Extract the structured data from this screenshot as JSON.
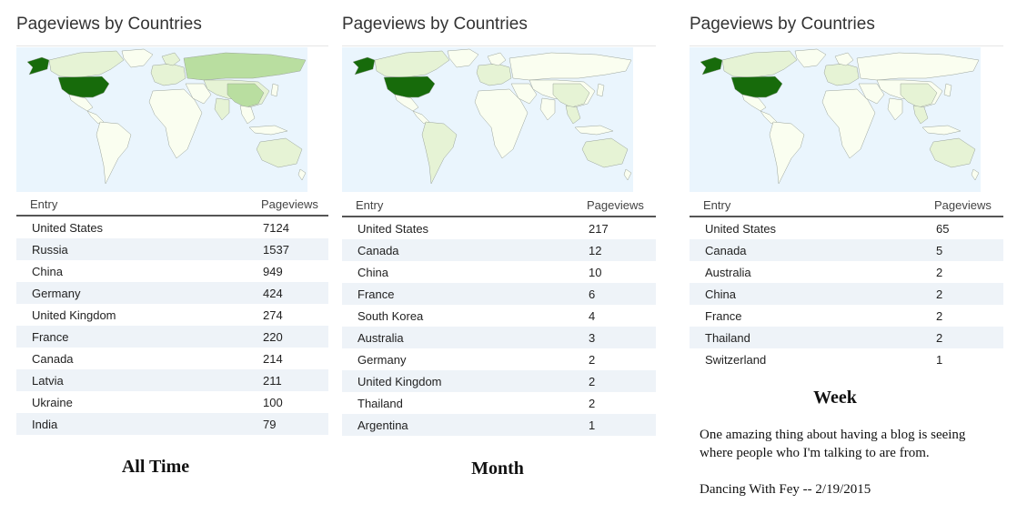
{
  "panels": [
    {
      "title": "Pageviews by Countries",
      "columns": {
        "entry": "Entry",
        "pageviews": "Pageviews"
      },
      "rows": [
        {
          "entry": "United States",
          "pageviews": "7124"
        },
        {
          "entry": "Russia",
          "pageviews": "1537"
        },
        {
          "entry": "China",
          "pageviews": "949"
        },
        {
          "entry": "Germany",
          "pageviews": "424"
        },
        {
          "entry": "United Kingdom",
          "pageviews": "274"
        },
        {
          "entry": "France",
          "pageviews": "220"
        },
        {
          "entry": "Canada",
          "pageviews": "214"
        },
        {
          "entry": "Latvia",
          "pageviews": "211"
        },
        {
          "entry": "Ukraine",
          "pageviews": "100"
        },
        {
          "entry": "India",
          "pageviews": "79"
        }
      ],
      "caption": "All Time"
    },
    {
      "title": "Pageviews by Countries",
      "columns": {
        "entry": "Entry",
        "pageviews": "Pageviews"
      },
      "rows": [
        {
          "entry": "United States",
          "pageviews": "217"
        },
        {
          "entry": "Canada",
          "pageviews": "12"
        },
        {
          "entry": "China",
          "pageviews": "10"
        },
        {
          "entry": "France",
          "pageviews": "6"
        },
        {
          "entry": "South Korea",
          "pageviews": "4"
        },
        {
          "entry": "Australia",
          "pageviews": "3"
        },
        {
          "entry": "Germany",
          "pageviews": "2"
        },
        {
          "entry": "United Kingdom",
          "pageviews": "2"
        },
        {
          "entry": "Thailand",
          "pageviews": "2"
        },
        {
          "entry": "Argentina",
          "pageviews": "1"
        }
      ],
      "caption": "Month"
    },
    {
      "title": "Pageviews by Countries",
      "columns": {
        "entry": "Entry",
        "pageviews": "Pageviews"
      },
      "rows": [
        {
          "entry": "United States",
          "pageviews": "65"
        },
        {
          "entry": "Canada",
          "pageviews": "5"
        },
        {
          "entry": "Australia",
          "pageviews": "2"
        },
        {
          "entry": "China",
          "pageviews": "2"
        },
        {
          "entry": "France",
          "pageviews": "2"
        },
        {
          "entry": "Thailand",
          "pageviews": "2"
        },
        {
          "entry": "Switzerland",
          "pageviews": "1"
        }
      ],
      "caption": "Week"
    }
  ],
  "note": {
    "line1": "One amazing thing about having a blog is seeing where people who I'm talking to are from.",
    "line2": "Dancing With Fey -- 2/19/2015"
  },
  "colors": {
    "ocean": "#eaf5fd",
    "land_none": "#fafef0",
    "land_low": "#e6f3d5",
    "land_mid": "#b9dea0",
    "land_top": "#176b0b",
    "row_alt": "#eef3f8"
  }
}
